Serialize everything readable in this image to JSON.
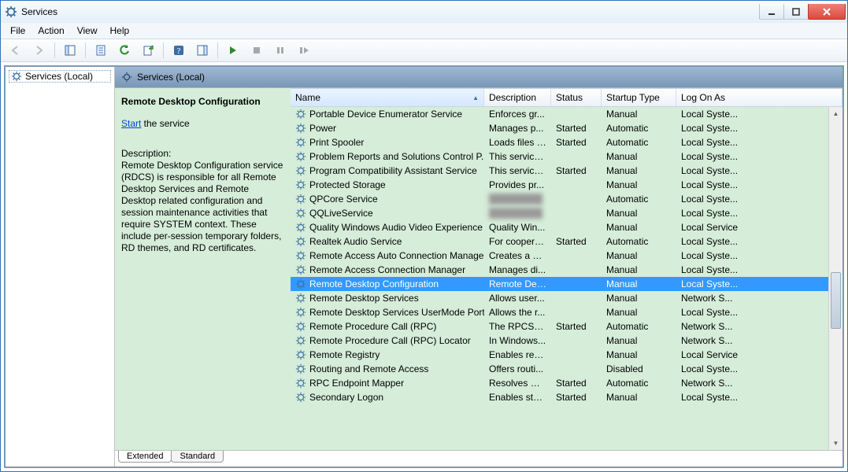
{
  "window": {
    "title": "Services"
  },
  "menus": {
    "file": "File",
    "action": "Action",
    "view": "View",
    "help": "Help"
  },
  "left": {
    "root": "Services (Local)"
  },
  "paneheader": {
    "title": "Services (Local)"
  },
  "detail": {
    "heading": "Remote Desktop Configuration",
    "start_link": "Start",
    "start_tail": " the service",
    "desc_label": "Description:",
    "desc_body": "Remote Desktop Configuration service (RDCS) is responsible for all Remote Desktop Services and Remote Desktop related configuration and session maintenance activities that require SYSTEM context. These include per-session temporary folders, RD themes, and RD certificates."
  },
  "columns": {
    "name": "Name",
    "desc": "Description",
    "status": "Status",
    "startup": "Startup Type",
    "logon": "Log On As"
  },
  "tabs": {
    "extended": "Extended",
    "standard": "Standard"
  },
  "services": [
    {
      "name": "Portable Device Enumerator Service",
      "desc": "Enforces gr...",
      "status": "",
      "startup": "Manual",
      "logon": "Local Syste...",
      "sel": false
    },
    {
      "name": "Power",
      "desc": "Manages p...",
      "status": "Started",
      "startup": "Automatic",
      "logon": "Local Syste...",
      "sel": false
    },
    {
      "name": "Print Spooler",
      "desc": "Loads files t...",
      "status": "Started",
      "startup": "Automatic",
      "logon": "Local Syste...",
      "sel": false
    },
    {
      "name": "Problem Reports and Solutions Control P...",
      "desc": "This service ...",
      "status": "",
      "startup": "Manual",
      "logon": "Local Syste...",
      "sel": false
    },
    {
      "name": "Program Compatibility Assistant Service",
      "desc": "This service ...",
      "status": "Started",
      "startup": "Manual",
      "logon": "Local Syste...",
      "sel": false
    },
    {
      "name": "Protected Storage",
      "desc": "Provides pr...",
      "status": "",
      "startup": "Manual",
      "logon": "Local Syste...",
      "sel": false
    },
    {
      "name": "QPCore Service",
      "desc": "",
      "status": "",
      "startup": "Automatic",
      "logon": "Local Syste...",
      "sel": false,
      "blurDesc": true
    },
    {
      "name": "QQLiveService",
      "desc": "",
      "status": "",
      "startup": "Manual",
      "logon": "Local Syste...",
      "sel": false,
      "blurDesc": true
    },
    {
      "name": "Quality Windows Audio Video Experience",
      "desc": "Quality Win...",
      "status": "",
      "startup": "Manual",
      "logon": "Local Service",
      "sel": false
    },
    {
      "name": "Realtek Audio Service",
      "desc": "For coopera...",
      "status": "Started",
      "startup": "Automatic",
      "logon": "Local Syste...",
      "sel": false
    },
    {
      "name": "Remote Access Auto Connection Manager",
      "desc": "Creates a co...",
      "status": "",
      "startup": "Manual",
      "logon": "Local Syste...",
      "sel": false
    },
    {
      "name": "Remote Access Connection Manager",
      "desc": "Manages di...",
      "status": "",
      "startup": "Manual",
      "logon": "Local Syste...",
      "sel": false
    },
    {
      "name": "Remote Desktop Configuration",
      "desc": "Remote Des...",
      "status": "",
      "startup": "Manual",
      "logon": "Local Syste...",
      "sel": true
    },
    {
      "name": "Remote Desktop Services",
      "desc": "Allows user...",
      "status": "",
      "startup": "Manual",
      "logon": "Network S...",
      "sel": false
    },
    {
      "name": "Remote Desktop Services UserMode Port ...",
      "desc": "Allows the r...",
      "status": "",
      "startup": "Manual",
      "logon": "Local Syste...",
      "sel": false
    },
    {
      "name": "Remote Procedure Call (RPC)",
      "desc": "The RPCSS ...",
      "status": "Started",
      "startup": "Automatic",
      "logon": "Network S...",
      "sel": false
    },
    {
      "name": "Remote Procedure Call (RPC) Locator",
      "desc": "In Windows...",
      "status": "",
      "startup": "Manual",
      "logon": "Network S...",
      "sel": false
    },
    {
      "name": "Remote Registry",
      "desc": "Enables rem...",
      "status": "",
      "startup": "Manual",
      "logon": "Local Service",
      "sel": false
    },
    {
      "name": "Routing and Remote Access",
      "desc": "Offers routi...",
      "status": "",
      "startup": "Disabled",
      "logon": "Local Syste...",
      "sel": false
    },
    {
      "name": "RPC Endpoint Mapper",
      "desc": "Resolves RP...",
      "status": "Started",
      "startup": "Automatic",
      "logon": "Network S...",
      "sel": false
    },
    {
      "name": "Secondary Logon",
      "desc": "Enables star...",
      "status": "Started",
      "startup": "Manual",
      "logon": "Local Syste...",
      "sel": false
    }
  ]
}
